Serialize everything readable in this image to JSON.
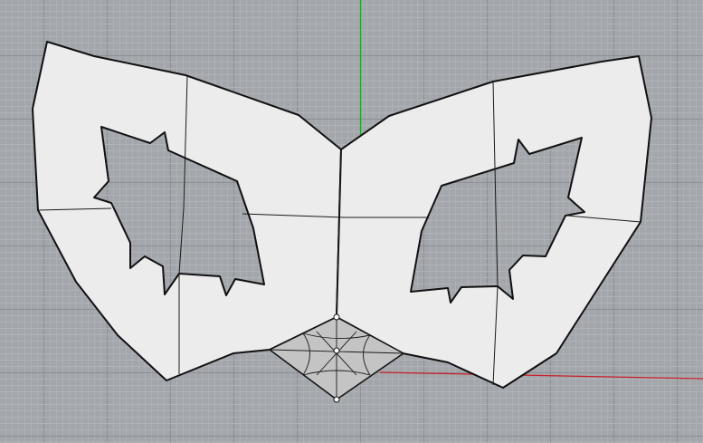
{
  "viewport": {
    "mode": "perspective-top",
    "background_color": "#a3a6ab",
    "grid": {
      "minor_color": "#b3b6ba",
      "major_color": "#8c8f94"
    },
    "axes": {
      "x_axis_color": "#c9202a",
      "y_axis_color": "#18a52a"
    }
  },
  "model": {
    "object_name": "mask",
    "surface_color": "#ececec",
    "edge_color": "#111111",
    "isocurve_color": "#1a1a1a",
    "selected_patch": {
      "fill_color": "#c4c4c4",
      "control_point_color": "#ffffff"
    }
  }
}
